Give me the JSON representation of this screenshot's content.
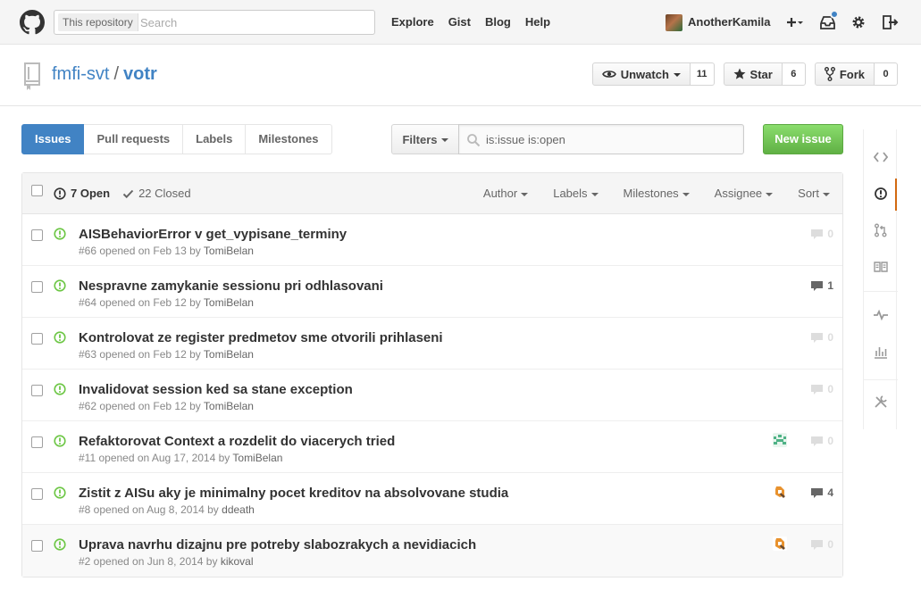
{
  "header": {
    "search_scope": "This repository",
    "search_placeholder": "Search",
    "nav": [
      "Explore",
      "Gist",
      "Blog",
      "Help"
    ],
    "username": "AnotherKamila"
  },
  "repo": {
    "owner": "fmfi-svt",
    "separator": "/",
    "name": "votr",
    "actions": {
      "watch": {
        "label": "Unwatch",
        "count": "11"
      },
      "star": {
        "label": "Star",
        "count": "6"
      },
      "fork": {
        "label": "Fork",
        "count": "0"
      }
    }
  },
  "subnav": {
    "items": [
      "Issues",
      "Pull requests",
      "Labels",
      "Milestones"
    ],
    "selected": "Issues",
    "filters_label": "Filters",
    "filter_query": "is:issue is:open",
    "new_issue_label": "New issue"
  },
  "issues_table": {
    "open_label": "7 Open",
    "closed_label": "22 Closed",
    "filters": [
      "Author",
      "Labels",
      "Milestones",
      "Assignee",
      "Sort"
    ],
    "rows": [
      {
        "title": "AISBehaviorError v get_vypisane_terminy",
        "meta": "#66 opened on Feb 13 by ",
        "author": "TomiBelan",
        "comments": "0",
        "assignee": ""
      },
      {
        "title": "Nespravne zamykanie sessionu pri odhlasovani",
        "meta": "#64 opened on Feb 12 by ",
        "author": "TomiBelan",
        "comments": "1",
        "assignee": ""
      },
      {
        "title": "Kontrolovat ze register predmetov sme otvorili prihlaseni",
        "meta": "#63 opened on Feb 12 by ",
        "author": "TomiBelan",
        "comments": "0",
        "assignee": ""
      },
      {
        "title": "Invalidovat session ked sa stane exception",
        "meta": "#62 opened on Feb 12 by ",
        "author": "TomiBelan",
        "comments": "0",
        "assignee": ""
      },
      {
        "title": "Refaktorovat Context a rozdelit do viacerych tried",
        "meta": "#11 opened on Aug 17, 2014 by ",
        "author": "TomiBelan",
        "comments": "0",
        "assignee": "green-identicon"
      },
      {
        "title": "Zistit z AISu aky je minimalny pocet kreditov na absolvovane studia",
        "meta": "#8 opened on Aug 8, 2014 by ",
        "author": "ddeath",
        "comments": "4",
        "assignee": "orange-identicon"
      },
      {
        "title": "Uprava navrhu dizajnu pre potreby slabozrakych a nevidiacich",
        "meta": "#2 opened on Jun 8, 2014 by ",
        "author": "kikoval",
        "comments": "0",
        "assignee": "orange-identicon"
      }
    ]
  },
  "repo_nav": [
    "code-icon",
    "issues-icon",
    "pull-requests-icon",
    "wiki-icon",
    "pulse-icon",
    "graphs-icon",
    "settings-icon"
  ],
  "colors": {
    "accent": "#4183c4",
    "open": "#6cc644",
    "active_nav": "#d26911",
    "new_issue": "#60b044"
  }
}
